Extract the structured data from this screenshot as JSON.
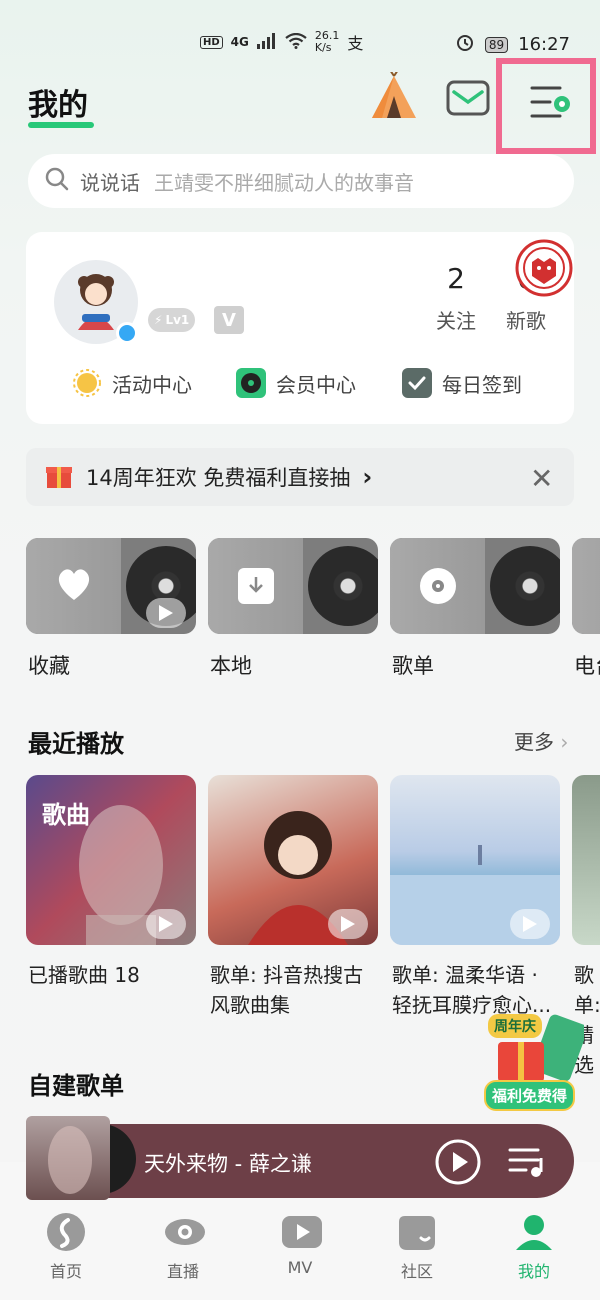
{
  "status_bar": {
    "left_text": "HD",
    "net": "4G",
    "speed": "26.1",
    "speed_unit": "K/s",
    "extra": "支",
    "battery": "89",
    "time": "16:27"
  },
  "header": {
    "title": "我的"
  },
  "search": {
    "label": "说说话",
    "placeholder": "王靖雯不胖细腻动人的故事音"
  },
  "profile": {
    "level": "Lv1",
    "vip": "V",
    "stats": [
      {
        "num": "2",
        "label": "关注"
      },
      {
        "num": "0",
        "label": "新歌"
      }
    ],
    "links": [
      {
        "label": "活动中心"
      },
      {
        "label": "会员中心"
      },
      {
        "label": "每日签到"
      }
    ]
  },
  "promo": {
    "text": "14周年狂欢 免费福利直接抽",
    "arrow": "›",
    "close": "✕"
  },
  "quick_tiles": [
    {
      "label": "收藏"
    },
    {
      "label": "本地"
    },
    {
      "label": "歌单"
    },
    {
      "label": "电台"
    }
  ],
  "recent": {
    "title": "最近播放",
    "more": "更多",
    "items": [
      {
        "overlay": "歌曲",
        "caption": "已播歌曲 18"
      },
      {
        "overlay": "",
        "caption": "歌单: 抖音热搜古风歌曲集"
      },
      {
        "overlay": "",
        "caption": "歌单: 温柔华语 · 轻抚耳膜疗愈心..."
      },
      {
        "overlay": "",
        "caption": "歌单: 精选"
      }
    ]
  },
  "floating_promo": {
    "top": "周年庆",
    "bottom": "福利免费得"
  },
  "my_playlists": {
    "title": "自建歌单"
  },
  "player": {
    "title": "天外来物 - 薛之谦"
  },
  "tabs": [
    {
      "label": "首页"
    },
    {
      "label": "直播"
    },
    {
      "label": "MV"
    },
    {
      "label": "社区"
    },
    {
      "label": "我的"
    }
  ],
  "colors": {
    "accent": "#20b46e",
    "highlight": "#f06a90",
    "player_bg": "#6d3f47"
  }
}
